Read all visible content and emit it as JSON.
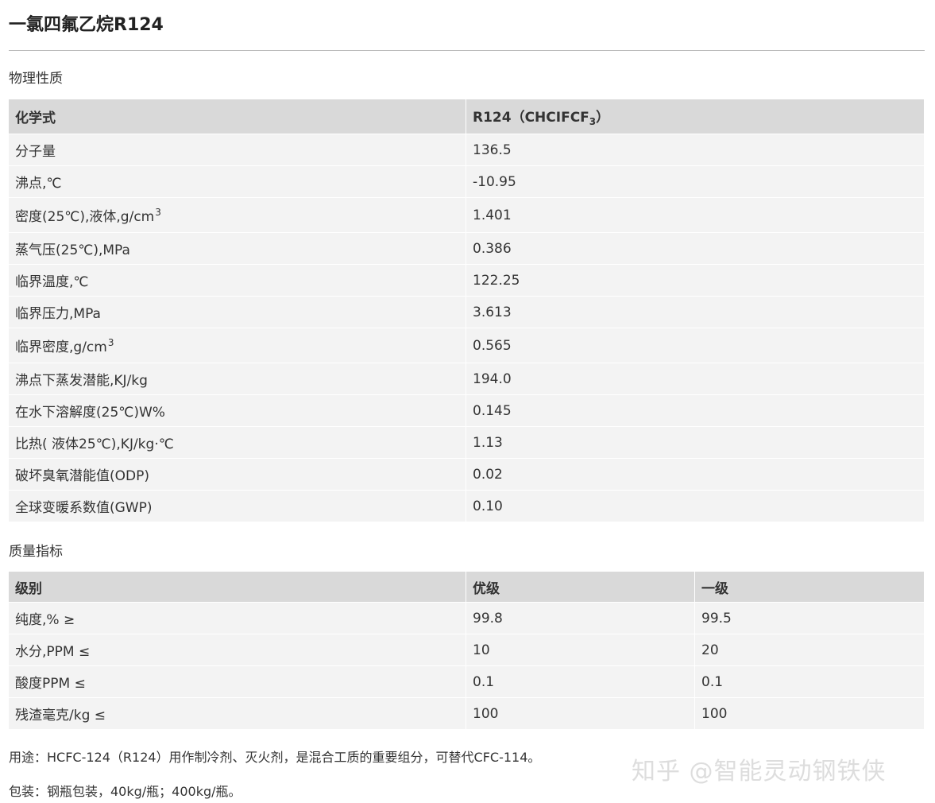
{
  "title": "一氯四氟乙烷R124",
  "physical": {
    "section_label": "物理性质",
    "header": {
      "col1": "化学式",
      "col2_prefix": "R124（CHCIFCF",
      "col2_sub": "3",
      "col2_suffix": "）"
    },
    "rows": [
      {
        "name": "分子量",
        "value": "136.5"
      },
      {
        "name": "沸点,℃",
        "value": "-10.95"
      },
      {
        "name": "密度(25℃),液体,g/cm",
        "sup": "3",
        "value": "1.401"
      },
      {
        "name": "蒸气压(25℃),MPa",
        "value": "0.386"
      },
      {
        "name": "临界温度,℃",
        "value": "122.25"
      },
      {
        "name": "临界压力,MPa",
        "value": "3.613"
      },
      {
        "name": "临界密度,g/cm",
        "sup": "3",
        "value": "0.565"
      },
      {
        "name": "沸点下蒸发潜能,KJ/kg",
        "value": "194.0"
      },
      {
        "name": "在水下溶解度(25℃)W%",
        "value": "0.145"
      },
      {
        "name": "比热( 液体25℃),KJ/kg·℃",
        "value": "1.13"
      },
      {
        "name": "破坏臭氧潜能值(ODP)",
        "value": "0.02"
      },
      {
        "name": "全球变暖系数值(GWP)",
        "value": "0.10"
      }
    ]
  },
  "quality": {
    "section_label": "质量指标",
    "headers": [
      "级别",
      "优级",
      "一级"
    ],
    "rows": [
      [
        "纯度,% ≥",
        "99.8",
        "99.5"
      ],
      [
        "水分,PPM ≤",
        "10",
        "20"
      ],
      [
        "酸度PPM ≤",
        "0.1",
        "0.1"
      ],
      [
        "残渣毫克/kg ≤",
        "100",
        "100"
      ]
    ]
  },
  "usage": "用途：HCFC-124（R124）用作制冷剂、灭火剂，是混合工质的重要组分，可替代CFC-114。",
  "packaging": "包装：钢瓶包装，40kg/瓶；400kg/瓶。",
  "watermark": "知乎 @智能灵动钢铁侠"
}
